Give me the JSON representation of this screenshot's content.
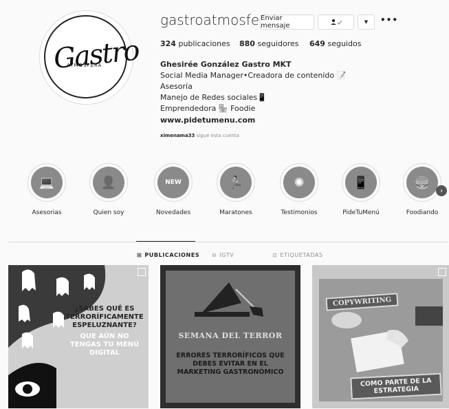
{
  "profile": {
    "username": "gastroatmosfera",
    "logo_text": "Gastro",
    "logo_sub": "ATMOSFERA",
    "message_button": "Enviar mensaje",
    "more_options": "•••",
    "stats": {
      "posts_count": "324",
      "posts_label": "publicaciones",
      "followers_count": "880",
      "followers_label": "seguidores",
      "following_count": "649",
      "following_label": "seguidos"
    },
    "bio_name": "Ghesirée González Gastro MKT",
    "bio_lines": [
      "Social Media Manager•Creadora de contenido 📝",
      "Asesoría",
      "Manejo de Redes sociales📱",
      "Emprendedora 🏪 Foodie"
    ],
    "website": "www.pidetumenu.com",
    "followed_by_user": "ximenama33",
    "followed_by_text": "sigue esta cuenta"
  },
  "highlights": [
    {
      "label": "Asesorias",
      "icon": "laptop-icon"
    },
    {
      "label": "Quien soy",
      "icon": "person-icon"
    },
    {
      "label": "Novedades",
      "icon": "new-badge-icon"
    },
    {
      "label": "Maratones",
      "icon": "runner-icon"
    },
    {
      "label": "Testimonios",
      "icon": "sparkle-icon"
    },
    {
      "label": "PideTuMenú",
      "icon": "phone-icon"
    },
    {
      "label": "Foodiando",
      "icon": "food-icon"
    }
  ],
  "tabs": [
    {
      "label": "PUBLICACIONES",
      "icon": "grid-icon",
      "active": true
    },
    {
      "label": "IGTV",
      "icon": "igtv-icon",
      "active": false
    },
    {
      "label": "ETIQUETADAS",
      "icon": "tag-icon",
      "active": false
    }
  ],
  "posts": [
    {
      "line1": "¿SABES QUÉ ES",
      "line2": "TERRORÍFICAMENTE",
      "line3": "ESPELUZNANTE?",
      "line4": "QUE AÚN NO",
      "line5": "TENGAS TU MENÚ",
      "line6": "DIGITAL"
    },
    {
      "title": "SEMANA DEL TERROR",
      "line1": "ERRORES TERRORÍFICOS QUE",
      "line2": "DEBES EVITAR EN EL",
      "line3": "MARKETING GASTRONÓMICO"
    },
    {
      "tag": "COPYWRITING",
      "line1": "COMO PARTE DE LA",
      "line2": "ESTRATEGIA"
    }
  ]
}
